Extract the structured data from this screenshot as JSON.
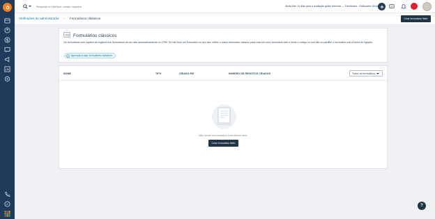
{
  "app": {
    "accent": "#f4801f",
    "rail_color": "#1f3a5a"
  },
  "topbar": {
    "search_placeholder": "Pesquisar no HubSpot, contas, negócios",
    "trial_text": "Ainda têm 14 dias para a avaliação grátis terminar — Freshsales · Estilosarte",
    "trial_link": "Ativar"
  },
  "breadcrumb": {
    "parent": "Definições de administrador",
    "separator": "›",
    "current": "Formulários clássicos"
  },
  "header_button": "Criar formulário Web",
  "info": {
    "title": "Formulários clássicos",
    "description": "Os formulários web captam os registos nos formulários do seu site automaticamente no CRM. Se não tiver um formulário no seu site, utilize o nosso formulário clássico para criar um novo formulário web e inicie o código no seu site ou partilhe o formulário sob a forma de ligação.",
    "learn_link": "Aprenda a usar formulários clássicos"
  },
  "table": {
    "columns": [
      "NOME",
      "TIPO",
      "CRIADO EM",
      "NÚMERO DE REGISTOS CRIADOS"
    ],
    "sort_marker": "↕",
    "filter_value": "Todos os formulários",
    "empty_message": "Não foram encontrados formulários web.",
    "empty_button": "Criar formulário Web"
  },
  "help_label": "?",
  "icons": {
    "rail": [
      "logo-icon",
      "calendar-icon",
      "contacts-icon",
      "dollar-icon",
      "chat-icon",
      "inbox-icon",
      "megaphone-icon",
      "reports-icon",
      "settings-icon",
      "phone-icon",
      "help-circle-icon",
      "apps-grid-icon"
    ]
  }
}
